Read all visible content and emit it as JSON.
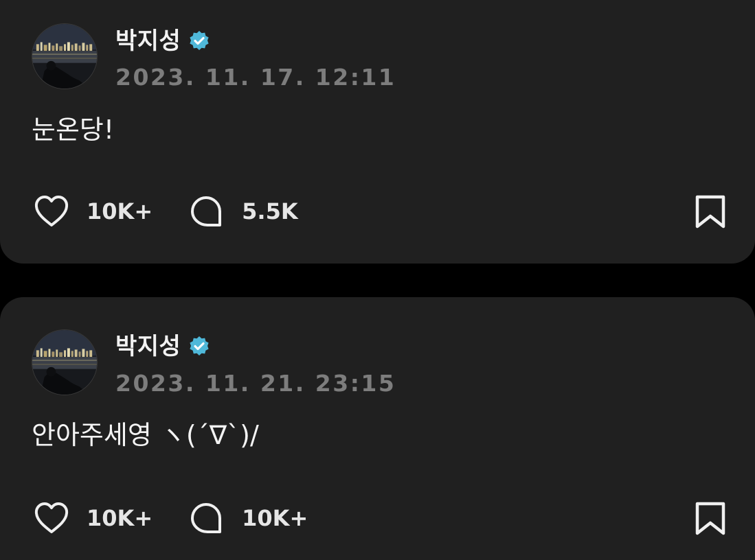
{
  "colors": {
    "background": "#000000",
    "card": "#202020",
    "name_text": "#f2f2f2",
    "timestamp_text": "#7d7d7d",
    "verified_badge": "#4fb8d9",
    "icon": "#f0f0f0"
  },
  "posts": [
    {
      "author": "박지성",
      "verified_icon": "verified-badge-icon",
      "timestamp": "2023. 11. 17. 12:11",
      "text": "눈온당!",
      "likes": "10K+",
      "comments": "5.5K",
      "icons": [
        "heart-icon",
        "comment-bubble-icon",
        "bookmark-icon"
      ]
    },
    {
      "author": "박지성",
      "verified_icon": "verified-badge-icon",
      "timestamp": "2023. 11. 21. 23:15",
      "text": "안아주세영 ヽ(´∇`)/",
      "likes": "10K+",
      "comments": "10K+",
      "icons": [
        "heart-icon",
        "comment-bubble-icon",
        "bookmark-icon"
      ]
    }
  ]
}
